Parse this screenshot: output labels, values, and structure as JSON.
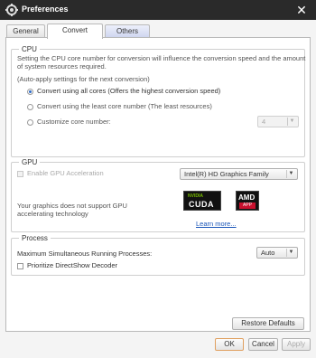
{
  "window": {
    "title": "Preferences",
    "close_glyph": "✕"
  },
  "tabs": [
    {
      "label": "General"
    },
    {
      "label": "Convert"
    },
    {
      "label": "Others"
    }
  ],
  "cpu": {
    "title": "CPU",
    "description_line1": "Setting the CPU core number for conversion will influence the conversion speed and the amount",
    "description_line2": "of system resources required.",
    "auto_apply": "(Auto-apply settings for the next conversion)",
    "options": [
      {
        "label": "Convert using all cores (Offers the highest conversion speed)",
        "checked": true
      },
      {
        "label": "Convert using the least core number (The least resources)",
        "checked": false
      },
      {
        "label": "Customize core number:",
        "checked": false
      }
    ],
    "core_number_value": "4"
  },
  "gpu": {
    "title": "GPU",
    "enable_label": "Enable GPU Acceleration",
    "gpu_select_value": "Intel(R) HD Graphics Family",
    "unsupported_line1": "Your graphics does not support GPU",
    "unsupported_line2": "accelerating technology",
    "nvidia_text": "NVIDIA",
    "cuda_text": "CUDA",
    "amd_text": "AMD",
    "app_text": "APP",
    "learn_more": "Learn more..."
  },
  "process": {
    "title": "Process",
    "max_label": "Maximum Simultaneous Running Processes:",
    "max_value": "Auto",
    "directshow_label": "Prioritize DirectShow Decoder"
  },
  "buttons": {
    "restore_defaults": "Restore Defaults",
    "ok": "OK",
    "cancel": "Cancel",
    "apply": "Apply"
  },
  "colors": {
    "titlebar": "#2a2a2a",
    "accent_radio": "#2d6bc8",
    "link": "#1a55b8"
  },
  "icons": {
    "app": "gear-icon",
    "close": "close-icon",
    "dropdown": "chevron-down-icon"
  }
}
